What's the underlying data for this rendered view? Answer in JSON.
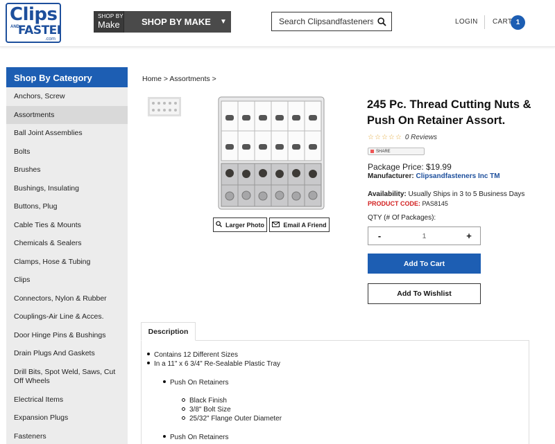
{
  "header": {
    "logo": {
      "line1": "Clips",
      "line2a": "AND",
      "line2b": "FASTENERS",
      "line3": ".com"
    },
    "shop_by_small": "SHOP BY",
    "shop_by_make_small": "Make",
    "shop_by_make": "SHOP BY MAKE",
    "search_placeholder": "Search Clipsandfasteners...",
    "login": "LOGIN",
    "cart": "CART",
    "cart_count": "1"
  },
  "sidebar": {
    "title": "Shop By Category",
    "items": [
      "Anchors, Screw",
      "Assortments",
      "Ball Joint Assemblies",
      "Bolts",
      "Brushes",
      "Bushings, Insulating",
      "Buttons, Plug",
      "Cable Ties & Mounts",
      "Chemicals & Sealers",
      "Clamps, Hose & Tubing",
      "Clips",
      "Connectors, Nylon & Rubber",
      "Couplings-Air Line & Acces.",
      "Door Hinge Pins & Bushings",
      "Drain Plugs And Gaskets",
      "Drill Bits, Spot Weld, Saws, Cut Off Wheels",
      "Electrical Items",
      "Expansion Plugs",
      "Fasteners"
    ]
  },
  "breadcrumb": "Home > Assortments >",
  "product": {
    "title": "245 Pc. Thread Cutting Nuts & Push On Retainer Assort.",
    "reviews": "0 Reviews",
    "share": "SHARE",
    "price": "Package Price: $19.99",
    "manufacturer_label": "Manufacturer:",
    "manufacturer": "Clipsandfasteners Inc TM",
    "availability_label": "Availability:",
    "availability": "Usually Ships in 3 to 5 Business Days",
    "code_label": "PRODUCT CODE:",
    "code": "PAS8145",
    "qty_label": "QTY (# Of Packages):",
    "qty_value": "1",
    "minus": "-",
    "plus": "+",
    "add_to_cart": "Add To Cart",
    "add_to_wishlist": "Add To Wishlist",
    "larger_photo": "Larger Photo",
    "email_friend": "Email A Friend"
  },
  "description": {
    "tab": "Description",
    "lines": [
      "Contains 12 Different Sizes",
      "In a 11\" x 6 3/4\" Re-Sealable Plastic Tray",
      "Push On Retainers",
      "Black Finish",
      "3/8\" Bolt Size",
      "25/32\" Flange Outer Diameter",
      "Push On Retainers"
    ]
  },
  "colors": {
    "brand_blue": "#1d5eb3",
    "code_red": "#d21f1f"
  }
}
